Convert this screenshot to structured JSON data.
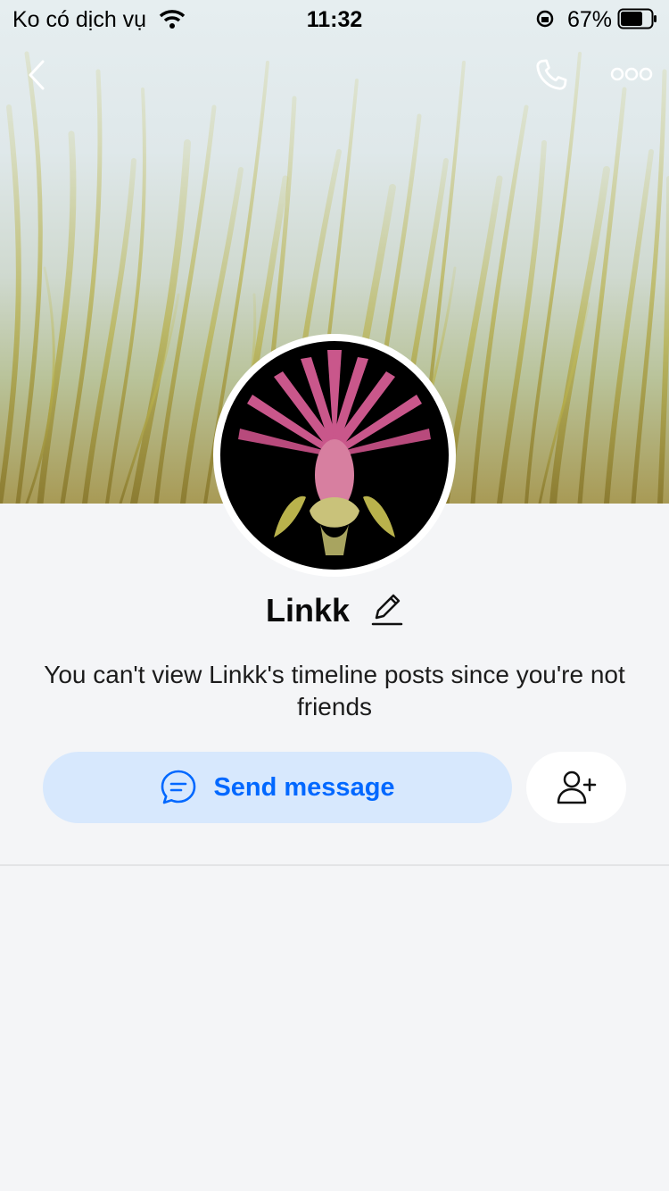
{
  "status_bar": {
    "carrier": "Ko có dịch vụ",
    "time": "11:32",
    "battery": "67%"
  },
  "profile": {
    "name": "Linkk",
    "notice": "You can't view Linkk's timeline posts since you're not friends"
  },
  "actions": {
    "send_message": "Send message"
  },
  "colors": {
    "accent": "#0068ff",
    "button_bg": "#d7e8fd",
    "page_bg": "#f4f5f7"
  },
  "icons": [
    "back-icon",
    "phone-icon",
    "more-icon",
    "edit-icon",
    "chat-icon",
    "add-friend-icon",
    "wifi-icon",
    "rotation-lock-icon",
    "battery-icon"
  ]
}
